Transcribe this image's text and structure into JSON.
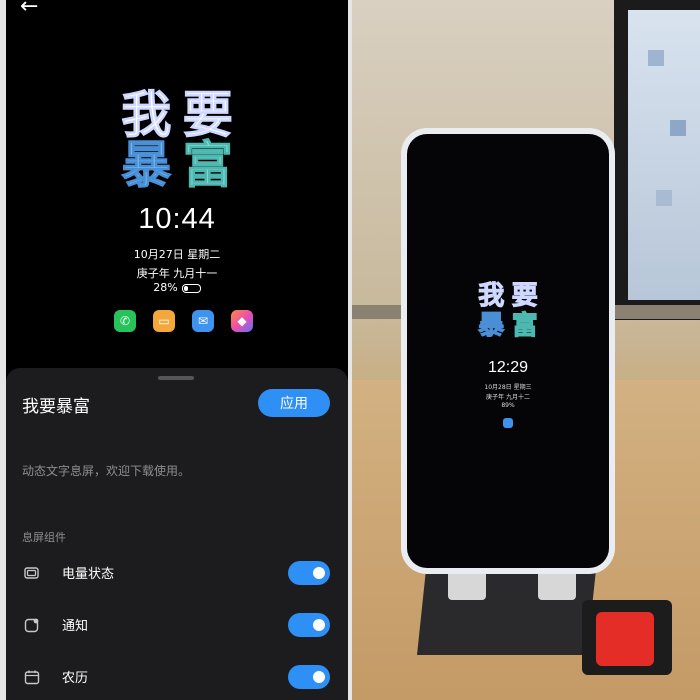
{
  "lockscreen": {
    "back_icon": "arrow-left-icon",
    "art_line1": [
      "我",
      "要"
    ],
    "art_line2": [
      "暴",
      "富"
    ],
    "time": "10:44",
    "date": "10月27日 星期二",
    "lunar": "庚子年 九月十一",
    "battery_text": "28%",
    "apps": [
      "phone-icon",
      "message-icon",
      "mail-icon",
      "theme-icon"
    ]
  },
  "sheet": {
    "title": "我要暴富",
    "apply_label": "应用",
    "description": "动态文字息屏，欢迎下载使用。",
    "section_label": "息屏组件",
    "options": [
      {
        "label": "电量状态",
        "icon": "battery-icon",
        "enabled": true
      },
      {
        "label": "通知",
        "icon": "notification-icon",
        "enabled": true
      },
      {
        "label": "农历",
        "icon": "calendar-icon",
        "enabled": true
      }
    ]
  },
  "photo": {
    "art_line1": [
      "我",
      "要"
    ],
    "art_line2": [
      "暴",
      "富"
    ],
    "time": "12:29",
    "date": "10月28日 星期三",
    "lunar": "庚子年 九月十二",
    "battery_text": "89%"
  },
  "colors": {
    "accent": "#2e8ff5",
    "background": "#000000",
    "sheet_bg": "#1c1c1e"
  }
}
